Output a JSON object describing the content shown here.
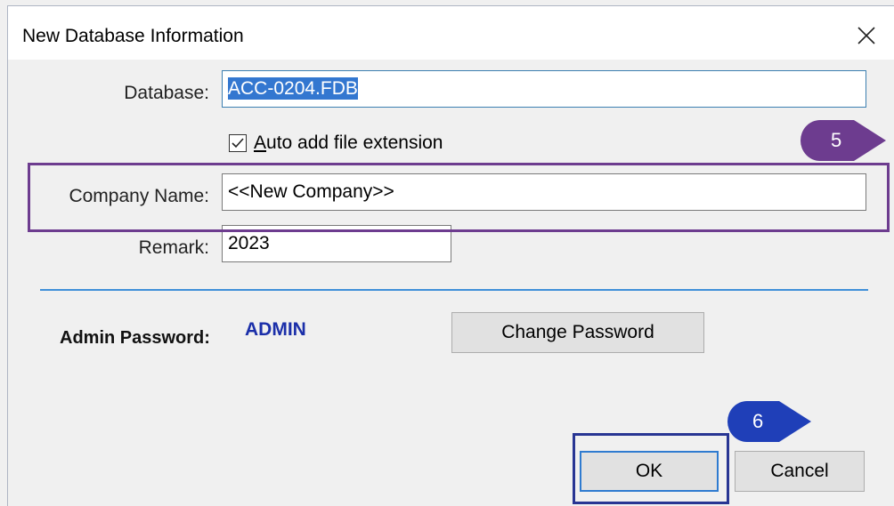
{
  "window": {
    "title": "New Database Information",
    "close_icon": "close-icon"
  },
  "form": {
    "database_label": "Database:",
    "database_value": "ACC-0204.FDB",
    "auto_ext_checked": true,
    "auto_ext_label_underlined": "A",
    "auto_ext_label_rest": "uto add file extension",
    "company_label": "Company Name:",
    "company_value": "<<New Company>>",
    "remark_label": "Remark:",
    "remark_value": "2023"
  },
  "admin": {
    "label": "Admin Password:",
    "value": "ADMIN",
    "change_button": "Change Password"
  },
  "buttons": {
    "ok": "OK",
    "cancel": "Cancel"
  },
  "annotations": {
    "step_5": "5",
    "step_6": "6",
    "purple": "#6d3c8f",
    "navy": "#283593",
    "step6_blue": "#1f3fb8"
  }
}
